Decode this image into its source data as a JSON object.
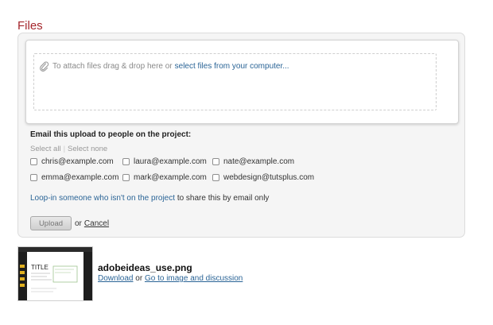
{
  "page": {
    "title": "Files"
  },
  "dropzone": {
    "text": "To attach files drag & drop here or",
    "link": "select files from your computer..."
  },
  "email": {
    "heading": "Email this upload to people on the project:",
    "select_all": "Select all",
    "separator": "|",
    "select_none": "Select none",
    "recipients": [
      "chris@example.com",
      "laura@example.com",
      "nate@example.com",
      "emma@example.com",
      "mark@example.com",
      "webdesign@tutsplus.com"
    ],
    "loop_link": "Loop-in someone who isn't on the project",
    "loop_rest": "to share this by email only"
  },
  "actions": {
    "upload": "Upload",
    "or": "or",
    "cancel": "Cancel"
  },
  "file": {
    "name": "adobeideas_use.png",
    "download": "Download",
    "or": "or",
    "go_to": "Go to image and discussion",
    "thumb_text": "TITLE"
  },
  "colors": {
    "title": "#a4262c",
    "link": "#2a6496",
    "panel_bg": "#f5f5f5"
  }
}
